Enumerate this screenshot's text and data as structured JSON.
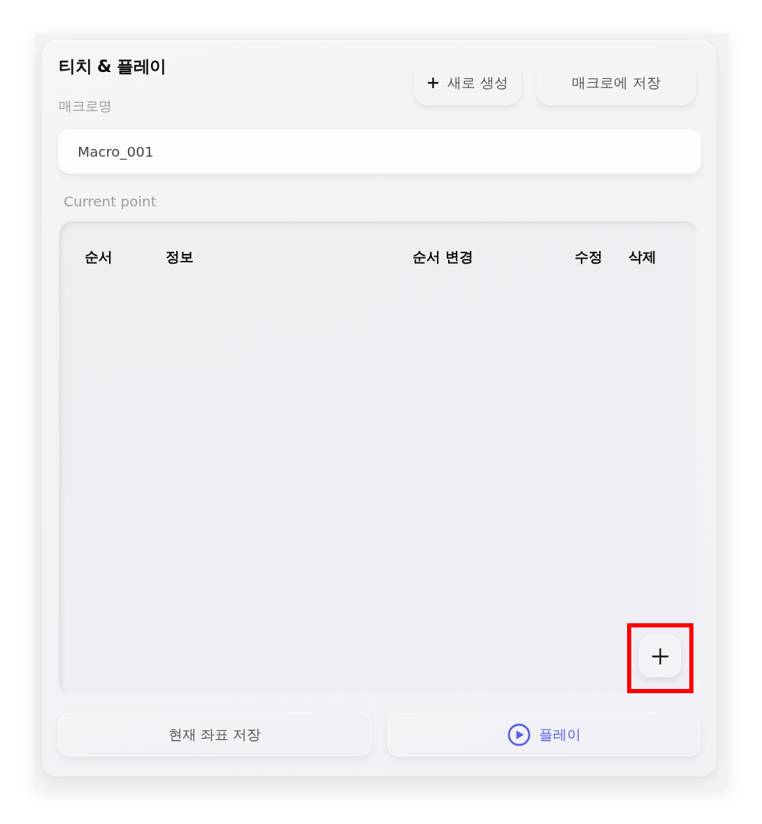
{
  "title": "티치 & 플레이",
  "header_buttons": [
    {
      "label": "새로 생성",
      "kind": "add"
    },
    {
      "label": "매크로에 저장",
      "kind": "plain"
    }
  ],
  "macro_name": {
    "label": "매크로명",
    "value": "Macro_001"
  },
  "points": {
    "label": "Current point",
    "columns": [
      "순서",
      "정보",
      "순서 변경",
      "수정",
      "삭제"
    ],
    "add_button": {
      "highlighted": true
    }
  },
  "footer_buttons": [
    {
      "label": "현재 좌표 저장",
      "kind": "plain"
    },
    {
      "label": "플레이",
      "kind": "play"
    }
  ]
}
